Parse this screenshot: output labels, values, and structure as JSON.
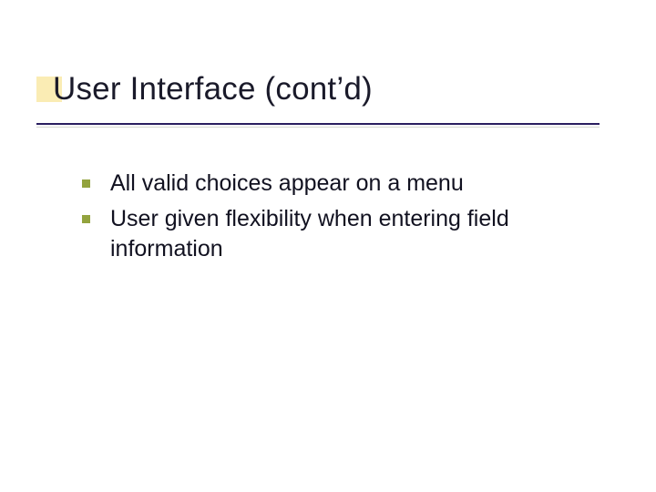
{
  "slide": {
    "title": "User Interface (cont’d)",
    "bullets": [
      "All valid choices appear on a menu",
      "User given flexibility when entering field information"
    ]
  },
  "colors": {
    "accent_square": "#faecb4",
    "underline": "#2a1e60",
    "bullet": "#93a33e"
  }
}
